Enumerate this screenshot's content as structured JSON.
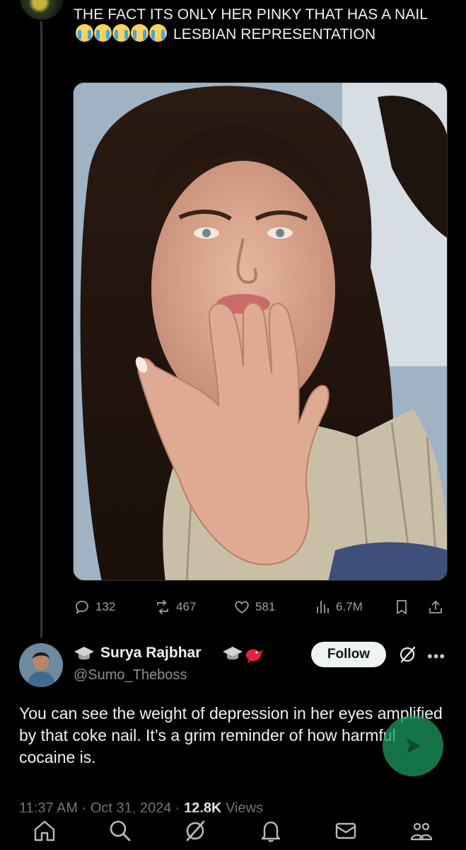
{
  "post": {
    "text_before": "THE FACT ITS ONLY HER PINKY THAT HAS A NAIL",
    "text_after": "LESBIAN REPRESENTATION",
    "emojis": [
      "loudly-crying-face",
      "loudly-crying-face",
      "loudly-crying-face",
      "loudly-crying-face",
      "loudly-crying-face"
    ],
    "media_icon": "woman-blowing-kiss-photo"
  },
  "actions": {
    "replies": "132",
    "reposts": "467",
    "likes": "581",
    "views": "6.7M"
  },
  "reply": {
    "name": "Surya Rajbhar",
    "handle": "@Sumo_Theboss",
    "follow_label": "Follow",
    "text": "You can see the weight of depression in her eyes amplified by that coke nail. It’s a grim reminder of how harmful cocaine is.",
    "time": "11:37 AM",
    "date": "Oct 31, 2024",
    "views_count": "12.8K",
    "views_label": "Views"
  },
  "colors": {
    "background": "#000000",
    "text": "#e7e9ea",
    "muted": "#71767b",
    "fab": "#1d9b5f"
  }
}
